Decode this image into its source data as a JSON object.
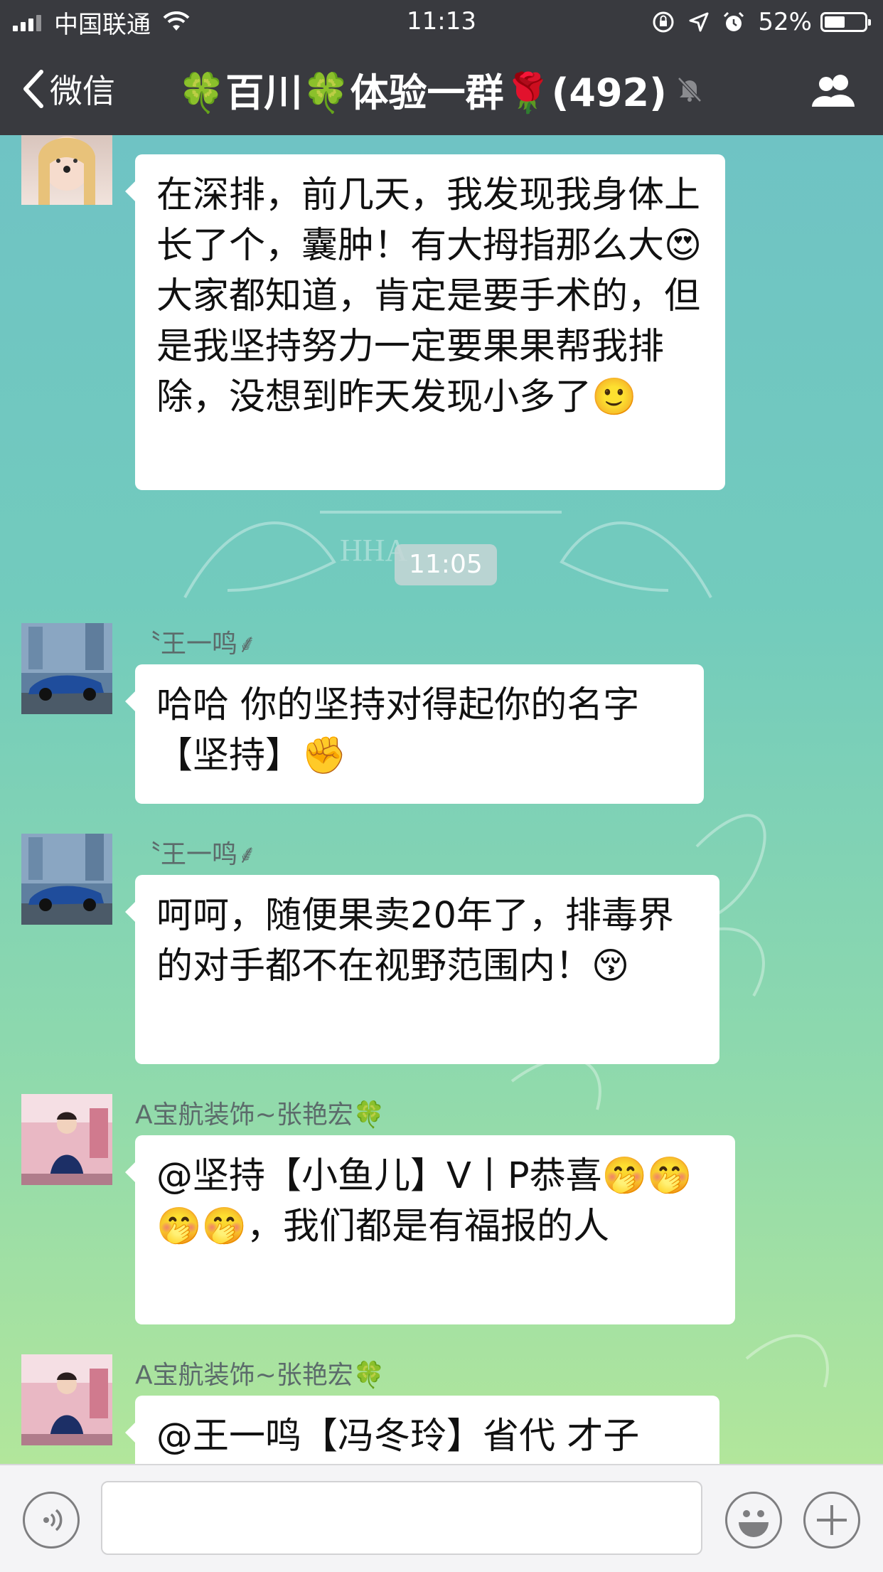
{
  "status_bar": {
    "carrier": "中国联通",
    "time": "11:13",
    "battery_percent_label": "52%",
    "battery_level": 0.52
  },
  "nav": {
    "back_label": "微信",
    "title": "🍀百川🍀体验一群🌹(492)"
  },
  "messages": [
    {
      "sender": "",
      "text": "在深排，前几天，我发现我身体上长了个，囊肿！有大拇指那么大😍大家都知道，肯定是要手术的，但是我坚持努力一定要果果帮我排除，没想到昨天发现小多了🙂"
    },
    {
      "sender": "〝王一鸣⸙",
      "text": "哈哈  你的坚持对得起你的名字【坚持】✊"
    },
    {
      "sender": "〝王一鸣⸙",
      "text": "呵呵，随便果卖20年了，排毒界的对手都不在视野范围内！😚"
    },
    {
      "sender": "A宝航装饰~张艳宏🍀",
      "text": "@坚持【小鱼儿】V丨P恭喜🤭🤭🤭🤭，我们都是有福报的人"
    },
    {
      "sender": "A宝航装饰~张艳宏🍀",
      "text": "@王一鸣【冯冬玲】省代 才子"
    }
  ],
  "time_divider": "11:05",
  "icons": {
    "back": "chevron-left-icon",
    "mute": "mute-bell-icon",
    "members": "group-members-icon",
    "voice": "voice-icon",
    "emoji": "emoji-icon",
    "more": "plus-icon"
  }
}
